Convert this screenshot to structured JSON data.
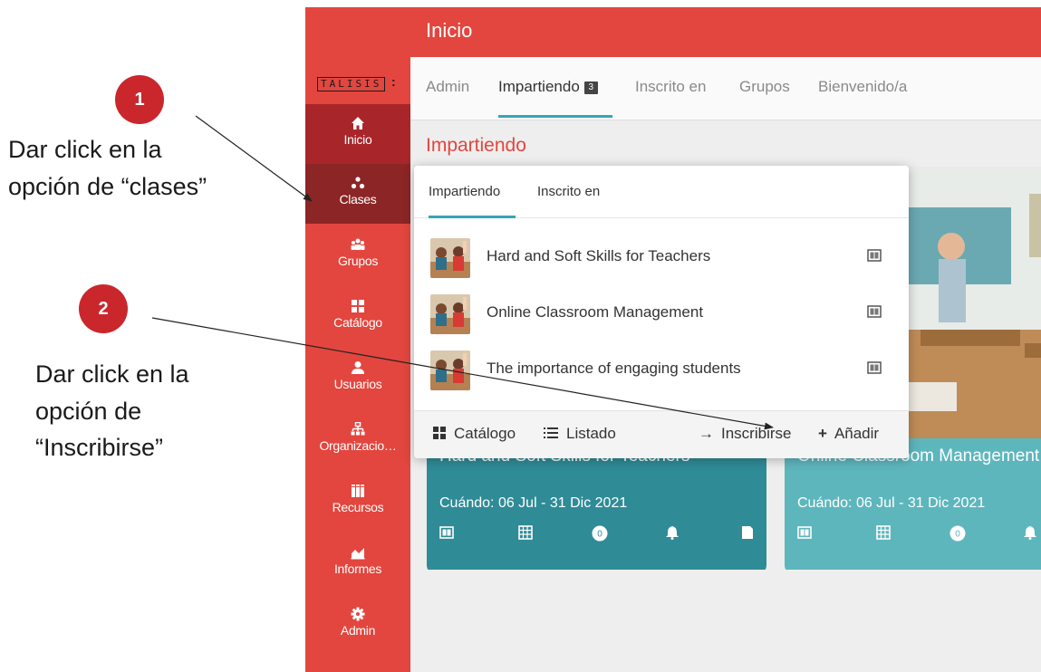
{
  "annotations": {
    "step1": {
      "number": "1",
      "text": "Dar click en la\nopción de “clases”"
    },
    "step2": {
      "number": "2",
      "text": "Dar click en la\nopción de\n“Inscribirse”"
    }
  },
  "app": {
    "title": "Inicio",
    "logo": "TALISIS",
    "sidebar": {
      "items": [
        {
          "label": "Inicio",
          "icon": "home-icon"
        },
        {
          "label": "Clases",
          "icon": "classes-icon"
        },
        {
          "label": "Grupos",
          "icon": "groups-icon"
        },
        {
          "label": "Catálogo",
          "icon": "catalog-icon"
        },
        {
          "label": "Usuarios",
          "icon": "user-icon"
        },
        {
          "label": "Organizacio…",
          "icon": "organization-icon"
        },
        {
          "label": "Recursos",
          "icon": "resources-icon"
        },
        {
          "label": "Informes",
          "icon": "reports-icon"
        },
        {
          "label": "Admin",
          "icon": "gear-icon"
        }
      ]
    },
    "tabs": [
      {
        "label": "Admin"
      },
      {
        "label": "Impartiendo",
        "badge": "3"
      },
      {
        "label": "Inscrito en"
      },
      {
        "label": "Grupos"
      },
      {
        "label": "Bienvenido/a"
      }
    ],
    "section_title": "Impartiendo",
    "cards": [
      {
        "name": "Hard and Soft Skills for Teachers",
        "date": "Cuándo: 06 Jul - 31 Dic 2021",
        "color": "#2f8b96"
      },
      {
        "name": "Online Classroom Management",
        "date": "Cuándo: 06 Jul - 31 Dic 2021",
        "color": "#5eb6bd"
      }
    ],
    "menu": {
      "tabs": [
        {
          "label": "Impartiendo"
        },
        {
          "label": "Inscrito en"
        }
      ],
      "courses": [
        {
          "title": "Hard and Soft Skills for Teachers"
        },
        {
          "title": "Online Classroom Management"
        },
        {
          "title": "The importance of engaging students"
        }
      ],
      "footer": {
        "catalog": "Catálogo",
        "list": "Listado",
        "enroll": "Inscribirse",
        "add": "Añadir"
      }
    }
  },
  "colors": {
    "brand_red": "#e2463e",
    "active_nav": "#a8262a",
    "teal": "#33a7b3",
    "badge_red": "#c9272c"
  }
}
